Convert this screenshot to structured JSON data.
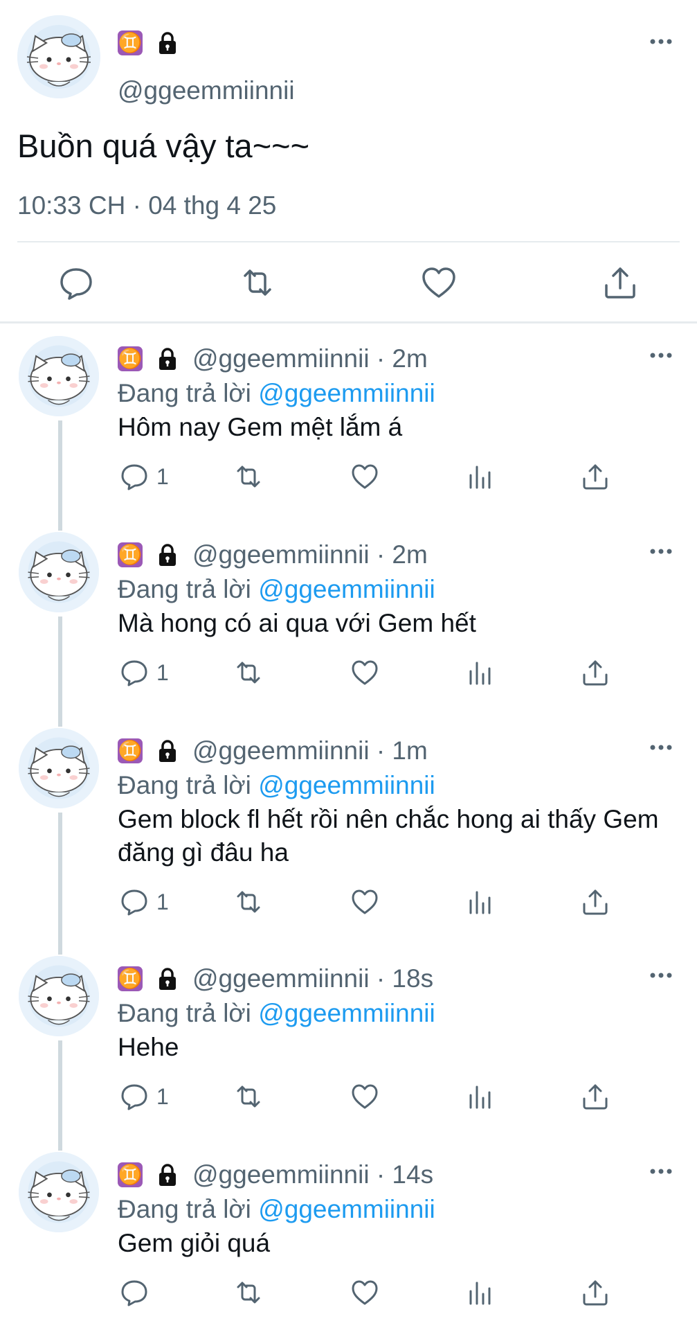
{
  "main_tweet": {
    "avatar": "cat-avatar",
    "badges": [
      "gemini-sign-icon",
      "lock-icon"
    ],
    "zodiac_glyph": "♊",
    "handle": "@ggeemmiinnii",
    "text": "Buồn quá vậy ta~~~",
    "timestamp": "10:33 CH · 04 thg 4 25",
    "actions": [
      "reply-icon",
      "retweet-icon",
      "like-icon",
      "share-icon"
    ]
  },
  "replies": [
    {
      "handle_time": "@ggeemmiinnii · 2m",
      "replying_prefix": "Đang trả lời ",
      "replying_to": "@ggeemmiinnii",
      "text": "Hôm nay Gem mệt lắm á",
      "reply_count": "1"
    },
    {
      "handle_time": "@ggeemmiinnii · 2m",
      "replying_prefix": "Đang trả lời ",
      "replying_to": "@ggeemmiinnii",
      "text": "Mà hong có ai qua với Gem hết",
      "reply_count": "1"
    },
    {
      "handle_time": "@ggeemmiinnii · 1m",
      "replying_prefix": "Đang trả lời ",
      "replying_to": "@ggeemmiinnii",
      "text": "Gem block fl hết rồi nên chắc hong ai thấy Gem đăng gì đâu ha",
      "reply_count": "1"
    },
    {
      "handle_time": "@ggeemmiinnii · 18s",
      "replying_prefix": "Đang trả lời ",
      "replying_to": "@ggeemmiinnii",
      "text": "Hehe",
      "reply_count": "1"
    },
    {
      "handle_time": "@ggeemmiinnii · 14s",
      "replying_prefix": "Đang trả lời ",
      "replying_to": "@ggeemmiinnii",
      "text": "Gem giỏi quá",
      "reply_count": ""
    }
  ],
  "colors": {
    "text": "#0f1419",
    "muted": "#536471",
    "mention": "#1d9bf0",
    "zodiac_badge": "#9b59b6",
    "divider": "#e6ebee",
    "thread_line": "#cfd9de"
  }
}
